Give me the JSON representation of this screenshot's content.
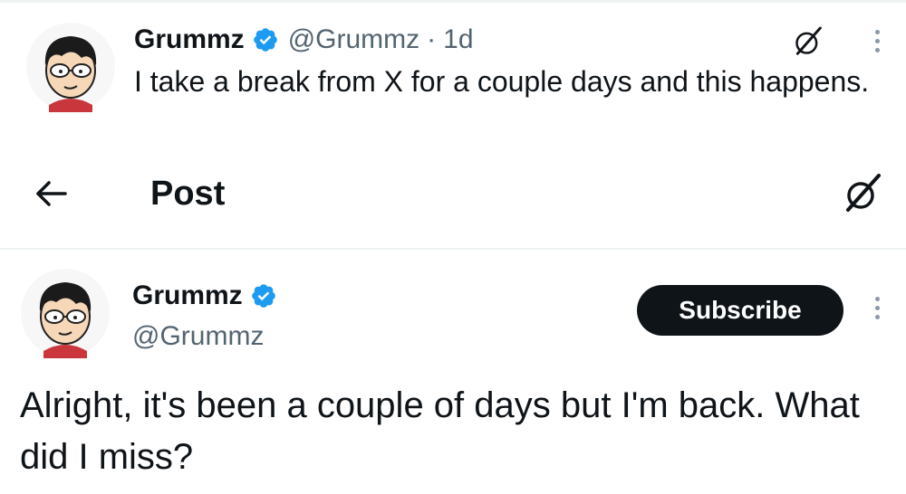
{
  "quoted_tweet": {
    "author_name": "Grummz",
    "handle": "@Grummz",
    "separator": "·",
    "time": "1d",
    "text": "I take a break from X for a couple days and this happens.",
    "verified": true,
    "avatar_icon": "cartoon-avatar-icon",
    "grok_icon": "grok-icon",
    "more_icon": "more-vertical-icon"
  },
  "header": {
    "back_icon": "arrow-left-icon",
    "title": "Post",
    "grok_icon": "grok-icon"
  },
  "main_post": {
    "author_name": "Grummz",
    "handle": "@Grummz",
    "verified": true,
    "subscribe_label": "Subscribe",
    "text": "Alright, it's been a couple of days but I'm back. What did I miss?",
    "more_icon": "more-vertical-icon"
  },
  "colors": {
    "text_primary": "#0f1419",
    "text_secondary": "#536471",
    "verified_blue": "#1d9bf0",
    "button_bg": "#0f1419",
    "divider": "#eff3f4"
  }
}
